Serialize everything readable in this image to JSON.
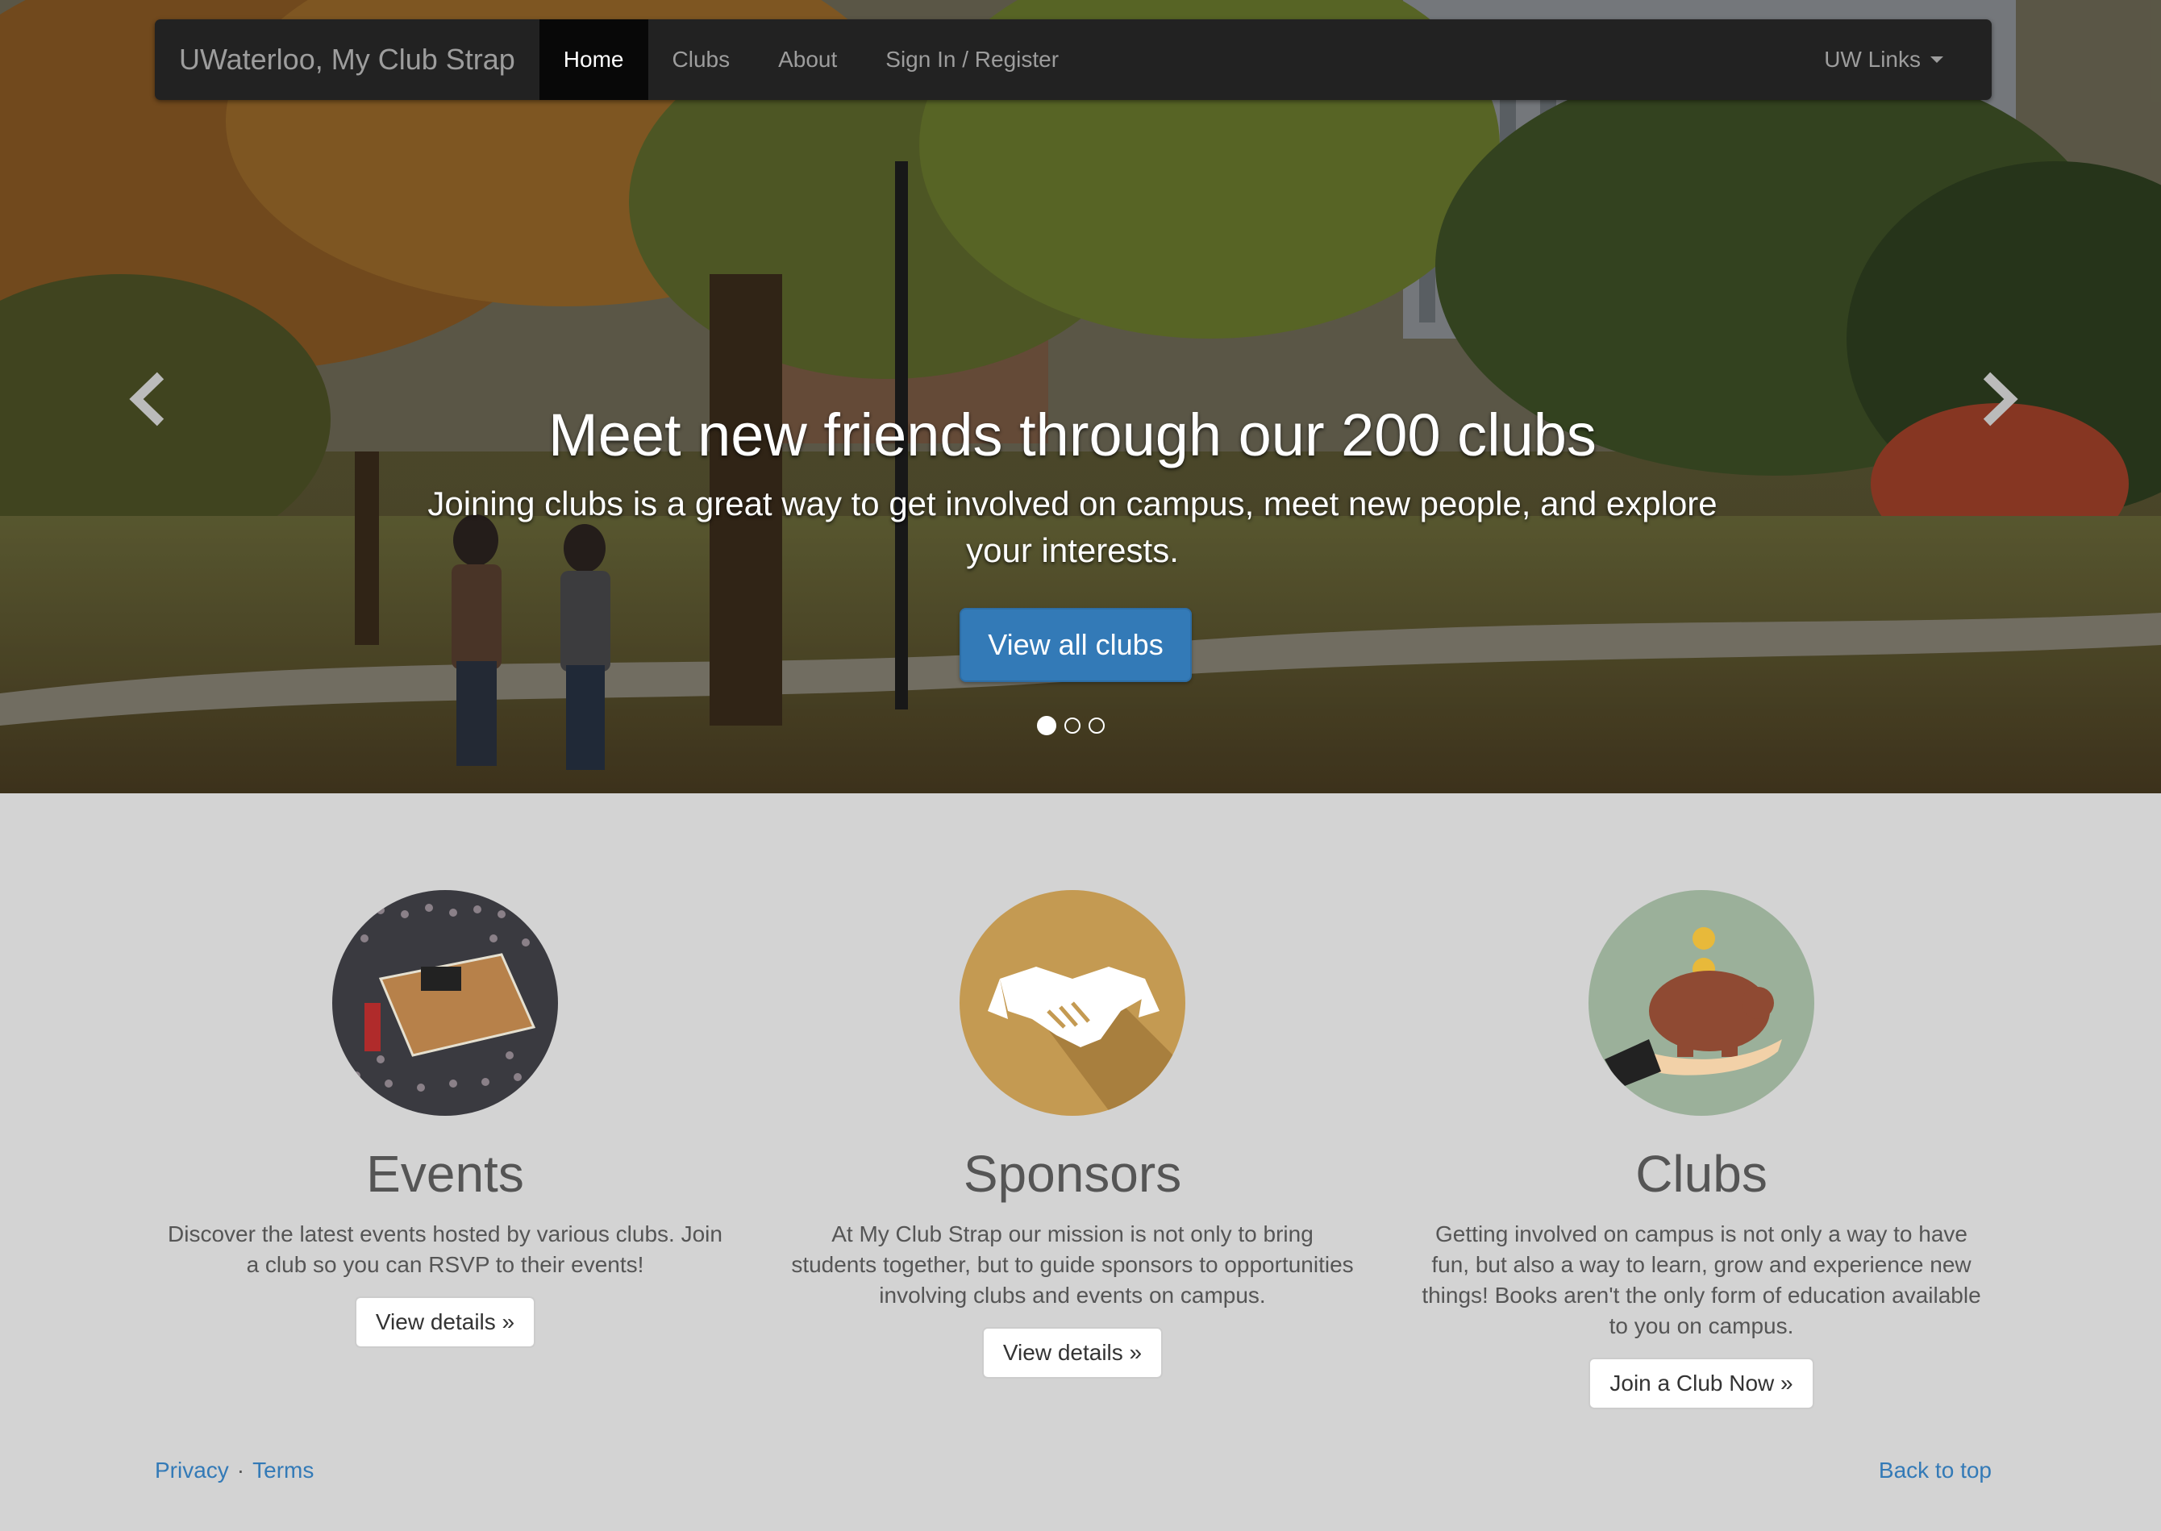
{
  "navbar": {
    "brand": "UWaterloo, My Club Strap",
    "items": [
      {
        "label": "Home",
        "active": true
      },
      {
        "label": "Clubs",
        "active": false
      },
      {
        "label": "About",
        "active": false
      },
      {
        "label": "Sign In / Register",
        "active": false
      }
    ],
    "dropdown_label": "UW Links"
  },
  "carousel": {
    "heading": "Meet new friends through our 200 clubs",
    "subtext": "Joining clubs is a great way to get involved on campus, meet new people, and explore your interests.",
    "button_label": "View all clubs",
    "slides": 3,
    "active_slide": 1,
    "prev_icon": "chevron-left-icon",
    "next_icon": "chevron-right-icon"
  },
  "features": [
    {
      "id": "events",
      "title": "Events",
      "text": "Discover the latest events hosted by various clubs. Join a club so you can RSVP to their events!",
      "button": "View details »",
      "icon": "crowd-photo"
    },
    {
      "id": "sponsors",
      "title": "Sponsors",
      "text": "At My Club Strap our mission is not only to bring students together, but to guide sponsors to opportunities involving clubs and events on campus.",
      "button": "View details »",
      "icon": "handshake-icon"
    },
    {
      "id": "clubs",
      "title": "Clubs",
      "text": "Getting involved on campus is not only a way to have fun, but also a way to learn, grow and experience new things! Books aren't the only form of education available to you on campus.",
      "button": "Join a Club Now »",
      "icon": "piggy-bank-icon"
    }
  ],
  "footer": {
    "privacy": "Privacy",
    "separator": "·",
    "terms": "Terms",
    "back_to_top": "Back to top"
  },
  "colors": {
    "primary": "#337ab7",
    "navbar_bg": "#222222",
    "page_bg": "#d3d3d3",
    "sponsors_circle": "#c49a52",
    "clubs_circle": "#9bb09a"
  }
}
